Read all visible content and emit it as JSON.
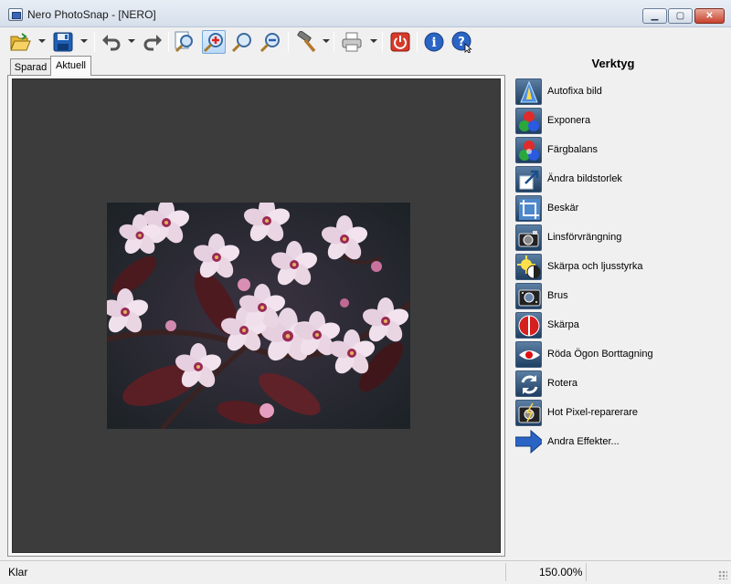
{
  "window": {
    "title": "Nero PhotoSnap - [NERO]",
    "icons": [
      "app-icon",
      "minimize-icon",
      "maximize-icon",
      "close-icon"
    ]
  },
  "toolbar": {
    "buttons": [
      {
        "name": "open",
        "icon": "folder-open-icon",
        "has_dropdown": true
      },
      {
        "name": "save",
        "icon": "floppy-disk-icon",
        "has_dropdown": true
      },
      {
        "name": "undo",
        "icon": "undo-icon",
        "has_dropdown": true
      },
      {
        "name": "redo",
        "icon": "redo-icon",
        "has_dropdown": false
      },
      {
        "name": "zoom-fit",
        "icon": "zoom-fit-icon",
        "has_dropdown": false
      },
      {
        "name": "zoom-in",
        "icon": "zoom-in-icon",
        "has_dropdown": false,
        "pressed": true
      },
      {
        "name": "zoom-actual",
        "icon": "zoom-actual-icon",
        "has_dropdown": false
      },
      {
        "name": "zoom-out",
        "icon": "zoom-out-icon",
        "has_dropdown": false
      },
      {
        "name": "tools",
        "icon": "hammer-icon",
        "has_dropdown": true
      },
      {
        "name": "print",
        "icon": "printer-icon",
        "has_dropdown": true
      },
      {
        "name": "exit",
        "icon": "power-icon",
        "has_dropdown": false
      },
      {
        "name": "info",
        "icon": "info-icon",
        "has_dropdown": false
      },
      {
        "name": "help",
        "icon": "help-icon",
        "has_dropdown": false
      }
    ]
  },
  "tabs": [
    {
      "label": "Sparad",
      "active": false
    },
    {
      "label": "Aktuell",
      "active": true
    }
  ],
  "canvas": {
    "background": "#3c3c3c",
    "image": "cherry-blossom-photo"
  },
  "tools_panel": {
    "title": "Verktyg",
    "items": [
      {
        "label": "Autofixa bild",
        "icon": "autofix-icon"
      },
      {
        "label": "Exponera",
        "icon": "exposure-icon"
      },
      {
        "label": "Färgbalans",
        "icon": "color-balance-icon"
      },
      {
        "label": "Ändra bildstorlek",
        "icon": "resize-icon"
      },
      {
        "label": "Beskär",
        "icon": "crop-icon"
      },
      {
        "label": "Linsförvrängning",
        "icon": "lens-distortion-icon"
      },
      {
        "label": "Skärpa och ljusstyrka",
        "icon": "sharpness-brightness-icon"
      },
      {
        "label": "Brus",
        "icon": "noise-icon"
      },
      {
        "label": "Skärpa",
        "icon": "sharpen-icon"
      },
      {
        "label": "Röda Ögon Borttagning",
        "icon": "red-eye-icon"
      },
      {
        "label": "Rotera",
        "icon": "rotate-icon"
      },
      {
        "label": "Hot Pixel-reparerare",
        "icon": "hot-pixel-icon"
      },
      {
        "label": "Andra Effekter...",
        "icon": "arrow-right-icon"
      }
    ]
  },
  "status": {
    "text": "Klar",
    "zoom": "150.00%"
  },
  "colors": {
    "window_bg": "#f0f0f0",
    "tool_icon_bg": "#2b4a6f",
    "close_button": "#c8412c"
  }
}
